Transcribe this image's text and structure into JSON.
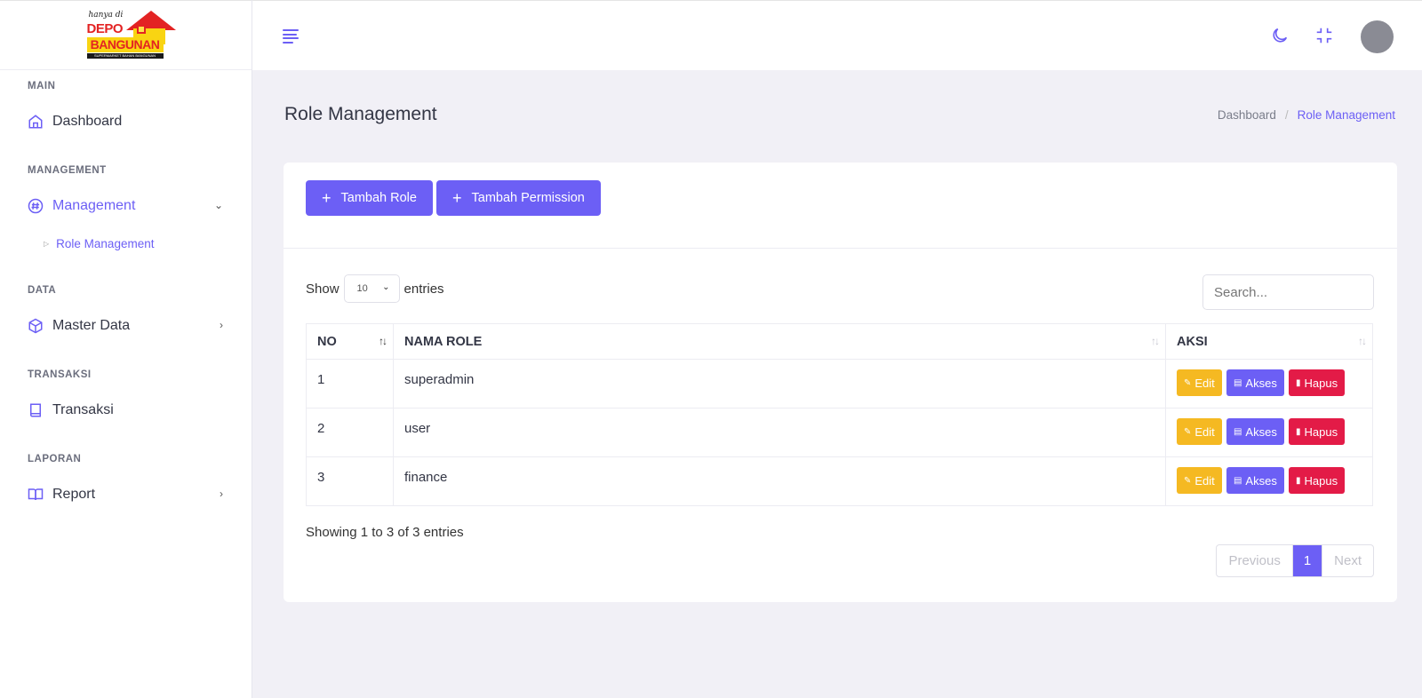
{
  "logo": {
    "tagline": "hanya di",
    "brand_line1": "DEPO",
    "brand_line2": "BANGUNAN",
    "subtitle": "SUPERMARKET BAHAN BANGUNAN"
  },
  "sidebar": {
    "sections": [
      {
        "label": "MAIN"
      },
      {
        "label": "MANAGEMENT"
      },
      {
        "label": "DATA"
      },
      {
        "label": "TRANSAKSI"
      },
      {
        "label": "LAPORAN"
      }
    ],
    "items": [
      {
        "label": "Dashboard",
        "icon": "home-icon"
      },
      {
        "label": "Management",
        "icon": "hash-icon",
        "expanded": true
      },
      {
        "label": "Master Data",
        "icon": "cube-icon"
      },
      {
        "label": "Transaksi",
        "icon": "book-icon"
      },
      {
        "label": "Report",
        "icon": "open-book-icon"
      }
    ],
    "sub_items": [
      {
        "label": "Role Management"
      }
    ]
  },
  "header": {
    "icons": [
      "menu-icon",
      "moon-icon",
      "minimize-icon",
      "avatar"
    ]
  },
  "page": {
    "title": "Role Management",
    "breadcrumb": {
      "home": "Dashboard",
      "separator": "/",
      "current": "Role Management"
    }
  },
  "toolbar": {
    "add_role": "Tambah Role",
    "add_permission": "Tambah Permission",
    "plus": "+"
  },
  "table_controls": {
    "show_label": "Show",
    "entries_value": "10",
    "entries_label": "entries",
    "search_placeholder": "Search..."
  },
  "table": {
    "columns": [
      "NO",
      "NAMA ROLE",
      "AKSI"
    ],
    "rows": [
      {
        "no": "1",
        "name": "superadmin"
      },
      {
        "no": "2",
        "name": "user"
      },
      {
        "no": "3",
        "name": "finance"
      }
    ],
    "actions": {
      "edit": "Edit",
      "akses": "Akses",
      "hapus": "Hapus"
    }
  },
  "footer": {
    "showing": "Showing 1 to 3 of 3 entries",
    "previous": "Previous",
    "page": "1",
    "next": "Next"
  },
  "colors": {
    "accent": "#6c5ff5",
    "edit": "#f5b922",
    "delete": "#e31b47",
    "background": "#f1f0f6"
  }
}
